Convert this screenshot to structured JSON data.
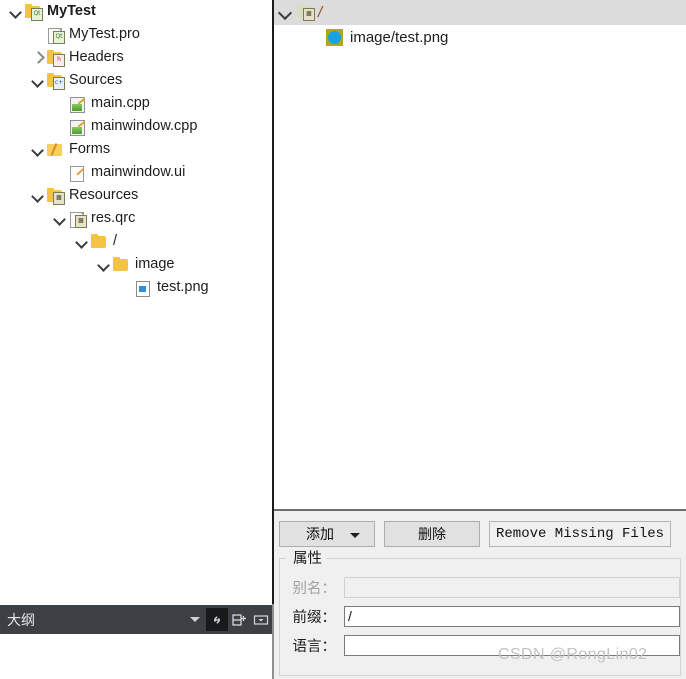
{
  "project_tree": {
    "items": [
      {
        "label": "MyTest",
        "indent": 0,
        "twisty": "open",
        "icon": "qt-project-folder-icon",
        "bold": true
      },
      {
        "label": "MyTest.pro",
        "indent": 1,
        "twisty": "none",
        "icon": "qt-pro-file-icon",
        "bold": false
      },
      {
        "label": "Headers",
        "indent": 1,
        "twisty": "closed",
        "icon": "headers-folder-icon",
        "bold": false
      },
      {
        "label": "Sources",
        "indent": 1,
        "twisty": "open",
        "icon": "sources-folder-icon",
        "bold": false
      },
      {
        "label": "main.cpp",
        "indent": 2,
        "twisty": "none",
        "icon": "cpp-file-icon",
        "bold": false
      },
      {
        "label": "mainwindow.cpp",
        "indent": 2,
        "twisty": "none",
        "icon": "cpp-file-icon",
        "bold": false
      },
      {
        "label": "Forms",
        "indent": 1,
        "twisty": "open",
        "icon": "forms-folder-icon",
        "bold": false
      },
      {
        "label": "mainwindow.ui",
        "indent": 2,
        "twisty": "none",
        "icon": "ui-file-icon",
        "bold": false
      },
      {
        "label": "Resources",
        "indent": 1,
        "twisty": "open",
        "icon": "resources-folder-icon",
        "bold": false
      },
      {
        "label": "res.qrc",
        "indent": 2,
        "twisty": "open",
        "icon": "qrc-file-icon",
        "bold": false
      },
      {
        "label": "/",
        "indent": 3,
        "twisty": "open",
        "icon": "folder-icon",
        "bold": false
      },
      {
        "label": "image",
        "indent": 4,
        "twisty": "open",
        "icon": "folder-icon",
        "bold": false
      },
      {
        "label": "test.png",
        "indent": 5,
        "twisty": "none",
        "icon": "png-file-icon",
        "bold": false
      }
    ]
  },
  "outline_bar": {
    "title": "大纲",
    "buttons": [
      {
        "name": "dropdown-caret",
        "icon": "chevron-down-icon",
        "active": false
      },
      {
        "name": "sync-link",
        "icon": "link-icon",
        "active": true
      },
      {
        "name": "split-add",
        "icon": "split-add-icon",
        "active": false
      },
      {
        "name": "filter-menu",
        "icon": "filter-menu-icon",
        "active": false
      }
    ]
  },
  "resource_tree": {
    "root": {
      "label": "/",
      "icon": "qrc-prefix-icon",
      "twisty": "open",
      "selected": true
    },
    "files": [
      {
        "label": "image/test.png",
        "icon": "png-image-icon"
      }
    ]
  },
  "toolbar": {
    "add_label": "添加",
    "remove_label": "删除",
    "remove_missing_label": "Remove Missing Files"
  },
  "properties": {
    "group_title": "属性",
    "alias": {
      "label": "别名：",
      "value": "",
      "placeholder": "",
      "disabled": true
    },
    "prefix": {
      "label": "前缀：",
      "value": "/",
      "placeholder": "",
      "disabled": false
    },
    "language": {
      "label": "语言：",
      "value": "",
      "placeholder": "",
      "disabled": false
    }
  },
  "watermark": {
    "text": "CSDN @RongLin02"
  },
  "colors": {
    "selection": "#dcdcdc",
    "outline_bar_bg": "#3c4044",
    "panel_bg": "#f0f0f0",
    "png_icon_blue": "#18a0e8",
    "png_icon_olive": "#b0a61d",
    "folder_yellow": "#f5c344"
  }
}
